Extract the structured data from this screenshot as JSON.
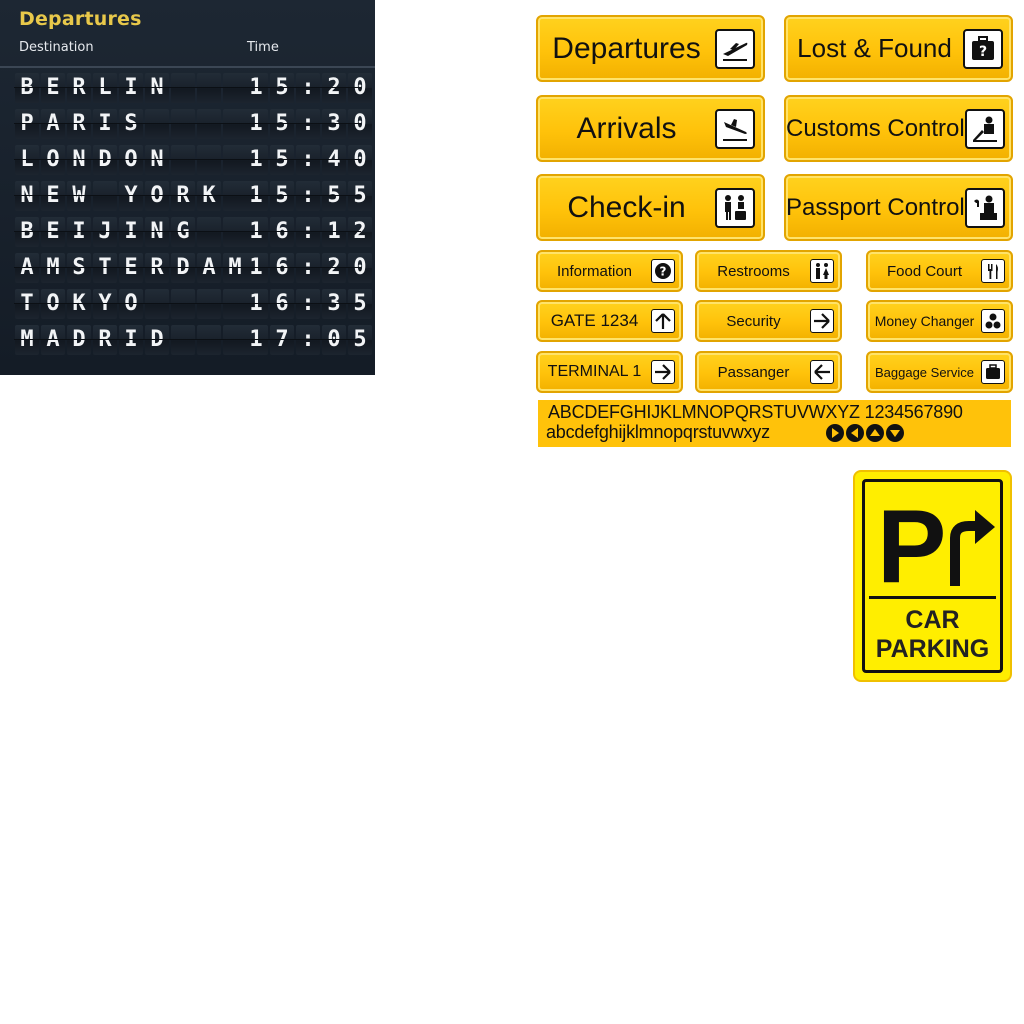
{
  "board": {
    "title": "Departures",
    "col_destination": "Destination",
    "col_time": "Time",
    "flights": [
      {
        "destination": "BERLIN",
        "time": "15:20"
      },
      {
        "destination": "PARIS",
        "time": "15:30"
      },
      {
        "destination": "LONDON",
        "time": "15:40"
      },
      {
        "destination": "NEW YORK",
        "time": "15:55"
      },
      {
        "destination": "BEIJING",
        "time": "16:12"
      },
      {
        "destination": "AMSTERDAM",
        "time": "16:20"
      },
      {
        "destination": "TOKYO",
        "time": "16:35"
      },
      {
        "destination": "MADRID",
        "time": "17:05"
      }
    ]
  },
  "signs": {
    "departures": {
      "label": "Departures",
      "icon": "airplane-takeoff-icon"
    },
    "lost_found": {
      "label": "Lost & Found",
      "icon": "luggage-question-icon"
    },
    "arrivals": {
      "label": "Arrivals",
      "icon": "airplane-landing-icon"
    },
    "customs": {
      "label": "Customs Control",
      "icon": "customs-officer-icon"
    },
    "checkin": {
      "label": "Check-in",
      "icon": "check-in-desk-icon"
    },
    "passport": {
      "label": "Passport Control",
      "icon": "passport-officer-icon"
    },
    "information": {
      "label": "Information",
      "icon": "question-icon"
    },
    "restrooms": {
      "label": "Restrooms",
      "icon": "restroom-icon"
    },
    "food_court": {
      "label": "Food Court",
      "icon": "fork-knife-icon"
    },
    "gate": {
      "label": "GATE 1234",
      "icon": "arrow-up-icon"
    },
    "security": {
      "label": "Security",
      "icon": "arrow-right-icon"
    },
    "money": {
      "label": "Money Changer",
      "icon": "coins-icon"
    },
    "terminal": {
      "label": "TERMINAL 1",
      "icon": "arrow-right-icon"
    },
    "passanger": {
      "label": "Passanger",
      "icon": "arrow-left-icon"
    },
    "baggage": {
      "label": "Baggage Service",
      "icon": "suitcase-icon"
    }
  },
  "alphabet": {
    "uppercase": "ABCDEFGHIJKLMNOPQRSTUVWXYZ 1234567890",
    "lowercase": "abcdefghijklmnopqrstuvwxyz"
  },
  "parking": {
    "line1": "CAR",
    "line2": "PARKING",
    "symbol": "P"
  },
  "colors": {
    "sign_yellow": "#ffc20a",
    "parking_yellow": "#ffee00",
    "board_bg": "#1d2733",
    "board_title": "#e8c84a"
  }
}
